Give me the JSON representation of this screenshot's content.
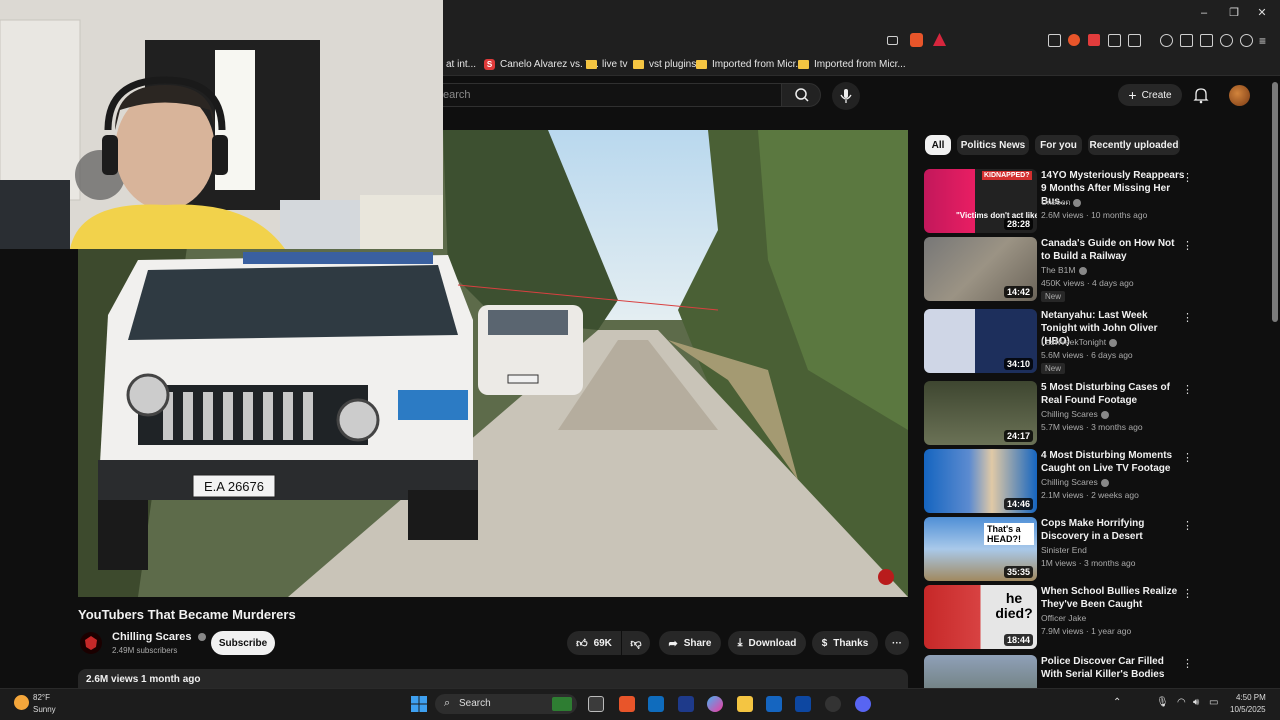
{
  "browser": {
    "bookmarks": [
      {
        "label": "at int..."
      },
      {
        "label": "Canelo Alvarez vs. T..."
      },
      {
        "label": "live tv"
      },
      {
        "label": "vst plugins"
      },
      {
        "label": "Imported from Micr..."
      },
      {
        "label": "Imported from Micr..."
      }
    ]
  },
  "header": {
    "search_placeholder": "earch",
    "create_label": "Create"
  },
  "video": {
    "title": "YouTubers That Became Murderers",
    "channel": "Chilling Scares",
    "subscribers": "2.49M subscribers",
    "subscribe_label": "Subscribe",
    "likes": "69K",
    "share_label": "Share",
    "download_label": "Download",
    "thanks_label": "Thanks",
    "description_meta": "2.6M views  1 month ago",
    "plate": "E.A  26676"
  },
  "chips": [
    "All",
    "Politics News",
    "For you",
    "Recently uploaded"
  ],
  "recommendations": [
    {
      "title": "14YO Mysteriously Reappears 9 Months After Missing Her Bus...",
      "channel": "Unseen",
      "meta": "2.6M views · 10 months ago",
      "duration": "28:28",
      "new": "",
      "thumb_overlay": "KIDNAPPED?",
      "thumb_caption": "\"Victims don't act like t"
    },
    {
      "title": "Canada's Guide on How Not to Build a Railway",
      "channel": "The B1M",
      "meta": "450K views · 4 days ago",
      "duration": "14:42",
      "new": "New"
    },
    {
      "title": "Netanyahu: Last Week Tonight with John Oliver (HBO)",
      "channel": "LastWeekTonight",
      "meta": "5.6M views · 6 days ago",
      "duration": "34:10",
      "new": "New"
    },
    {
      "title": "5 Most Disturbing Cases of Real Found Footage",
      "channel": "Chilling Scares",
      "meta": "5.7M views · 3 months ago",
      "duration": "24:17",
      "new": ""
    },
    {
      "title": "4 Most Disturbing Moments Caught on Live TV Footage",
      "channel": "Chilling Scares",
      "meta": "2.1M views · 2 weeks ago",
      "duration": "14:46",
      "new": ""
    },
    {
      "title": "Cops Make Horrifying Discovery in a Desert",
      "channel": "Sinister End",
      "meta": "1M views · 3 months ago",
      "duration": "35:35",
      "new": "",
      "thumb_overlay": "That's a HEAD?!"
    },
    {
      "title": "When School Bullies Realize They've Been Caught",
      "channel": "Officer Jake",
      "meta": "7.9M views · 1 year ago",
      "duration": "18:44",
      "new": "",
      "thumb_overlay": "he died?"
    },
    {
      "title": "Police Discover Car Filled With Serial Killer's Bodies",
      "channel": "",
      "meta": "",
      "duration": "",
      "new": ""
    }
  ],
  "taskbar": {
    "weather_temp": "82°F",
    "weather_desc": "Sunny",
    "search_label": "Search",
    "time": "4:50 PM",
    "date": "10/5/2025"
  }
}
